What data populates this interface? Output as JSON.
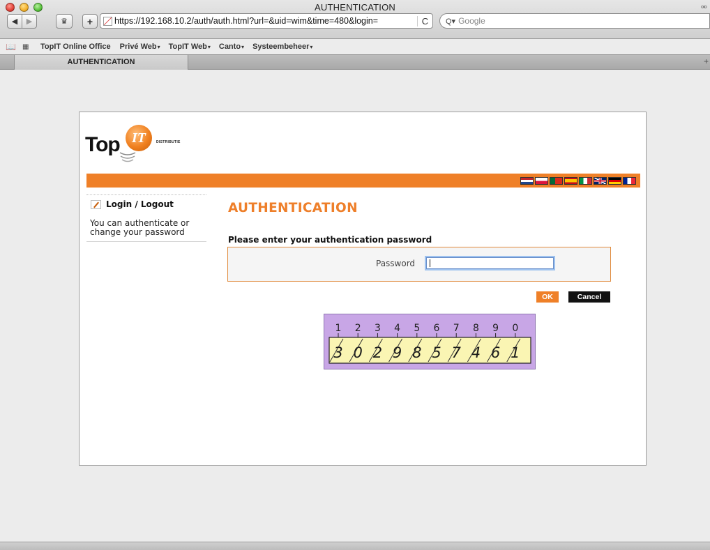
{
  "window": {
    "title": "AUTHENTICATION"
  },
  "toolbar": {
    "back": "◀",
    "forward": "▶",
    "add": "+",
    "url": "https://192.168.10.2/auth/auth.html?url=&uid=wim&time=480&login=",
    "reload": "C",
    "search_placeholder": "Google",
    "search_icon_glyph": "Q▾"
  },
  "bookmarks": {
    "book_glyph": "📖",
    "grid_glyph": "▦",
    "items": [
      {
        "label": "TopIT Online Office",
        "arrow": ""
      },
      {
        "label": "Privé Web",
        "arrow": "▾"
      },
      {
        "label": "TopIT Web",
        "arrow": "▾"
      },
      {
        "label": "Canto",
        "arrow": "▾"
      },
      {
        "label": "Systeembeheer",
        "arrow": "▾"
      }
    ]
  },
  "tabs": [
    {
      "label": "AUTHENTICATION"
    }
  ],
  "tab_add": "+",
  "logo": {
    "word": "Top",
    "circle": "IT",
    "sub": "DISTRIBUTIE"
  },
  "flags": [
    "nl",
    "pl",
    "pt",
    "es",
    "it",
    "uk",
    "de",
    "fr"
  ],
  "sidebar": {
    "heading": "Login / Logout",
    "description": "You can authenticate or change your password"
  },
  "main": {
    "title": "AUTHENTICATION",
    "prompt": "Please enter your authentication password",
    "password_label": "Password",
    "password_value": "",
    "ok_label": "OK",
    "cancel_label": "Cancel"
  },
  "keypad": {
    "top": [
      "1",
      "2",
      "3",
      "4",
      "5",
      "6",
      "7",
      "8",
      "9",
      "0"
    ],
    "bottom": [
      "3",
      "0",
      "2",
      "9",
      "8",
      "5",
      "7",
      "4",
      "6",
      "1"
    ]
  },
  "colors": {
    "accent": "#ef8028",
    "keypad_bg": "#c8a6e6",
    "strip_bg": "#faf5b3"
  }
}
